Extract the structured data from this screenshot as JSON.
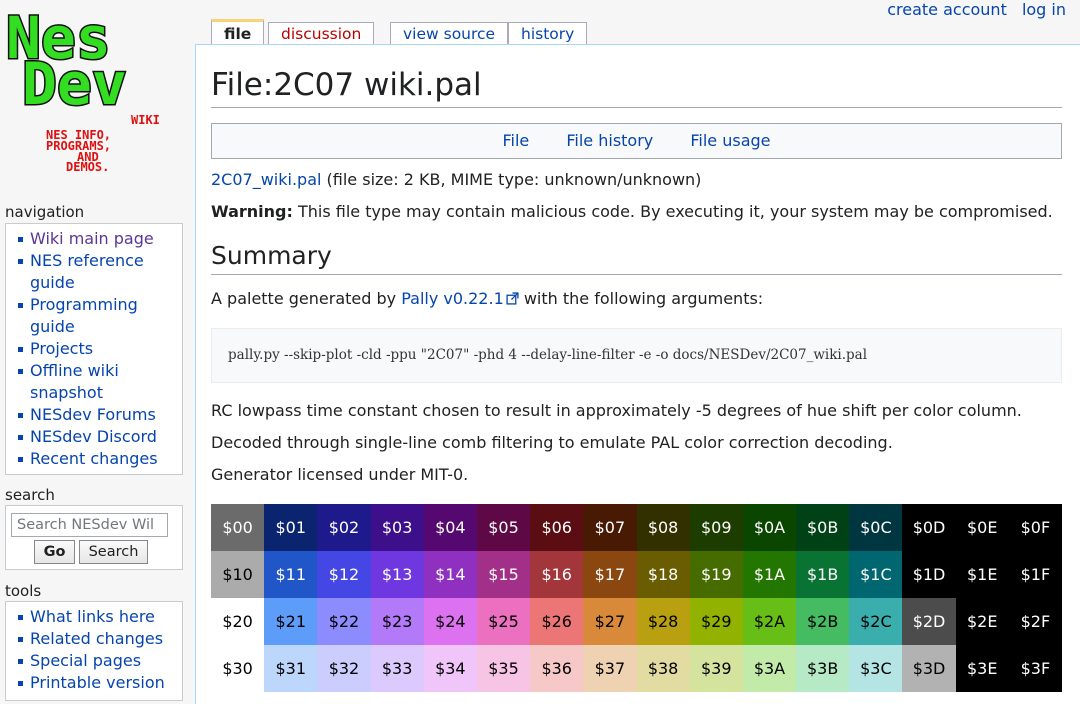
{
  "logo": {
    "line1": "Nes",
    "line2": "Dev",
    "wiki": "WIKI",
    "tag1": "NES INFO,",
    "tag2": "PROGRAMS,",
    "tag3": "AND",
    "tag4": "DEMOS."
  },
  "personal": {
    "create_account": "create account",
    "log_in": "log in"
  },
  "tabs": {
    "file": "file",
    "discussion": "discussion",
    "view_source": "view source",
    "history": "history"
  },
  "page": {
    "title": "File:2C07 wiki.pal",
    "toc": [
      "File",
      "File history",
      "File usage"
    ],
    "file_link": "2C07_wiki.pal",
    "file_info": " (file size: 2 KB, MIME type: unknown/unknown)",
    "warning_label": "Warning:",
    "warning_text": " This file type may contain malicious code. By executing it, your system may be compromised.",
    "summary_heading": "Summary",
    "intro_before": "A palette generated by ",
    "intro_link": "Pally v0.22.1",
    "intro_after": " with the following arguments:",
    "command": "pally.py --skip-plot -cld -ppu \"2C07\" -phd 4 --delay-line-filter -e -o docs/NESDev/2C07_wiki.pal",
    "line1": "RC lowpass time constant chosen to result in approximately -5 degrees of hue shift per color column.",
    "line2": "Decoded through single-line comb filtering to emulate PAL color correction decoding.",
    "line3": "Generator licensed under MIT-0."
  },
  "palette": {
    "rows": [
      [
        {
          "l": "$00",
          "bg": "#6b6b6b",
          "fg": "#ffffff"
        },
        {
          "l": "$01",
          "bg": "#0a2470",
          "fg": "#ffffff"
        },
        {
          "l": "$02",
          "bg": "#1e1a8c",
          "fg": "#ffffff"
        },
        {
          "l": "$03",
          "bg": "#3d0f8a",
          "fg": "#ffffff"
        },
        {
          "l": "$04",
          "bg": "#550870",
          "fg": "#ffffff"
        },
        {
          "l": "$05",
          "bg": "#5e0845",
          "fg": "#ffffff"
        },
        {
          "l": "$06",
          "bg": "#5a0d12",
          "fg": "#ffffff"
        },
        {
          "l": "$07",
          "bg": "#481a03",
          "fg": "#ffffff"
        },
        {
          "l": "$08",
          "bg": "#333000",
          "fg": "#ffffff"
        },
        {
          "l": "$09",
          "bg": "#1d3d00",
          "fg": "#ffffff"
        },
        {
          "l": "$0A",
          "bg": "#0b4600",
          "fg": "#ffffff"
        },
        {
          "l": "$0B",
          "bg": "#004215",
          "fg": "#ffffff"
        },
        {
          "l": "$0C",
          "bg": "#00363f",
          "fg": "#ffffff"
        },
        {
          "l": "$0D",
          "bg": "#000000",
          "fg": "#ffffff"
        },
        {
          "l": "$0E",
          "bg": "#000000",
          "fg": "#ffffff"
        },
        {
          "l": "$0F",
          "bg": "#000000",
          "fg": "#ffffff"
        }
      ],
      [
        {
          "l": "$10",
          "bg": "#ababab",
          "fg": "#000000"
        },
        {
          "l": "$11",
          "bg": "#2056c8",
          "fg": "#ffffff"
        },
        {
          "l": "$12",
          "bg": "#4447e4",
          "fg": "#ffffff"
        },
        {
          "l": "$13",
          "bg": "#6e37e0",
          "fg": "#ffffff"
        },
        {
          "l": "$14",
          "bg": "#9030c0",
          "fg": "#ffffff"
        },
        {
          "l": "$15",
          "bg": "#a22f88",
          "fg": "#ffffff"
        },
        {
          "l": "$16",
          "bg": "#a2363a",
          "fg": "#ffffff"
        },
        {
          "l": "$17",
          "bg": "#8a4810",
          "fg": "#ffffff"
        },
        {
          "l": "$18",
          "bg": "#6a5c00",
          "fg": "#ffffff"
        },
        {
          "l": "$19",
          "bg": "#466c00",
          "fg": "#ffffff"
        },
        {
          "l": "$1A",
          "bg": "#237700",
          "fg": "#ffffff"
        },
        {
          "l": "$1B",
          "bg": "#087333",
          "fg": "#ffffff"
        },
        {
          "l": "$1C",
          "bg": "#006670",
          "fg": "#ffffff"
        },
        {
          "l": "$1D",
          "bg": "#000000",
          "fg": "#ffffff"
        },
        {
          "l": "$1E",
          "bg": "#000000",
          "fg": "#ffffff"
        },
        {
          "l": "$1F",
          "bg": "#000000",
          "fg": "#ffffff"
        }
      ],
      [
        {
          "l": "$20",
          "bg": "#ffffff",
          "fg": "#000000"
        },
        {
          "l": "$21",
          "bg": "#5e9cfa",
          "fg": "#000000"
        },
        {
          "l": "$22",
          "bg": "#8c8cff",
          "fg": "#000000"
        },
        {
          "l": "$23",
          "bg": "#b27af8",
          "fg": "#000000"
        },
        {
          "l": "$24",
          "bg": "#dc72f0",
          "fg": "#000000"
        },
        {
          "l": "$25",
          "bg": "#ec70c0",
          "fg": "#000000"
        },
        {
          "l": "$26",
          "bg": "#ec7676",
          "fg": "#000000"
        },
        {
          "l": "$27",
          "bg": "#d88a3a",
          "fg": "#000000"
        },
        {
          "l": "$28",
          "bg": "#b8a010",
          "fg": "#000000"
        },
        {
          "l": "$29",
          "bg": "#92b200",
          "fg": "#000000"
        },
        {
          "l": "$2A",
          "bg": "#66be16",
          "fg": "#000000"
        },
        {
          "l": "$2B",
          "bg": "#46bc62",
          "fg": "#000000"
        },
        {
          "l": "$2C",
          "bg": "#3aaeac",
          "fg": "#000000"
        },
        {
          "l": "$2D",
          "bg": "#4c4c4c",
          "fg": "#ffffff"
        },
        {
          "l": "$2E",
          "bg": "#000000",
          "fg": "#ffffff"
        },
        {
          "l": "$2F",
          "bg": "#000000",
          "fg": "#ffffff"
        }
      ],
      [
        {
          "l": "$30",
          "bg": "#ffffff",
          "fg": "#000000"
        },
        {
          "l": "$31",
          "bg": "#bcd6fc",
          "fg": "#000000"
        },
        {
          "l": "$32",
          "bg": "#cccdff",
          "fg": "#000000"
        },
        {
          "l": "$33",
          "bg": "#dccaff",
          "fg": "#000000"
        },
        {
          "l": "$34",
          "bg": "#f0c6fa",
          "fg": "#000000"
        },
        {
          "l": "$35",
          "bg": "#f8c4e6",
          "fg": "#000000"
        },
        {
          "l": "$36",
          "bg": "#f6c8c8",
          "fg": "#000000"
        },
        {
          "l": "$37",
          "bg": "#eed2b2",
          "fg": "#000000"
        },
        {
          "l": "$38",
          "bg": "#e2dca2",
          "fg": "#000000"
        },
        {
          "l": "$39",
          "bg": "#d4e49e",
          "fg": "#000000"
        },
        {
          "l": "$3A",
          "bg": "#c2eaa8",
          "fg": "#000000"
        },
        {
          "l": "$3B",
          "bg": "#b6eac6",
          "fg": "#000000"
        },
        {
          "l": "$3C",
          "bg": "#b4e4e4",
          "fg": "#000000"
        },
        {
          "l": "$3D",
          "bg": "#b2b2b2",
          "fg": "#000000"
        },
        {
          "l": "$3E",
          "bg": "#000000",
          "fg": "#ffffff"
        },
        {
          "l": "$3F",
          "bg": "#000000",
          "fg": "#ffffff"
        }
      ]
    ]
  },
  "sidebar": {
    "navigation": {
      "heading": "navigation",
      "items": [
        [
          "Wiki main page"
        ],
        [
          "NES reference",
          "guide"
        ],
        [
          "Programming",
          "guide"
        ],
        [
          "Projects"
        ],
        [
          "Offline wiki",
          "snapshot"
        ],
        [
          "NESdev Forums"
        ],
        [
          "NESdev Discord"
        ],
        [
          "Recent changes"
        ]
      ]
    },
    "search": {
      "heading": "search",
      "placeholder": "Search NESdev Wil",
      "go": "Go",
      "search": "Search"
    },
    "tools": {
      "heading": "tools",
      "items": [
        "What links here",
        "Related changes",
        "Special pages",
        "Printable version"
      ]
    }
  },
  "colors": {
    "link": "#0645ad",
    "visited": "#5a3696",
    "redlink": "#ba0000",
    "logo_green": "#22cc22"
  }
}
